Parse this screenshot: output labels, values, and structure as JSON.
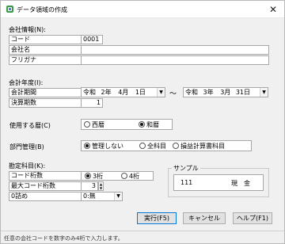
{
  "window": {
    "title": "データ領域の作成"
  },
  "company": {
    "section_label": "会社情報(N):",
    "code_label": "コード",
    "code_value": "0001",
    "name_label": "会社名",
    "name_value": "",
    "kana_label": "フリガナ",
    "kana_value": ""
  },
  "fiscal": {
    "section_label": "会計年度(I):",
    "period_label": "会計期間",
    "start": {
      "era": "令和",
      "year": "2年",
      "month": "4月",
      "day": "1日"
    },
    "tilde": "～",
    "end": {
      "era": "令和",
      "year": "3年",
      "month": "3月",
      "day": "31日"
    },
    "closing_label": "決算期数",
    "closing_value": "1"
  },
  "calendar": {
    "label": "使用する暦(C)",
    "options": [
      "西暦",
      "和暦"
    ],
    "selected": 1
  },
  "department": {
    "label": "部門管理(B)",
    "options": [
      "管理しない",
      "全科目",
      "損益計算書科目"
    ],
    "selected": 0
  },
  "accounts": {
    "section_label": "勘定科目(K):",
    "digits_label": "コード桁数",
    "digits_options": [
      "3桁",
      "4桁"
    ],
    "digits_selected": 0,
    "max_label": "最大コード桁数",
    "max_value": "3",
    "zero_label": "0詰め",
    "zero_value": "0:無"
  },
  "sample": {
    "label": "サンプル",
    "code": "111",
    "name": "現　金"
  },
  "buttons": {
    "execute": "実行(F5)",
    "cancel": "キャンセル",
    "help": "ヘルプ(F1)"
  },
  "status": {
    "text": "任意の会社コードを数字のみ4桁で入力します。"
  }
}
